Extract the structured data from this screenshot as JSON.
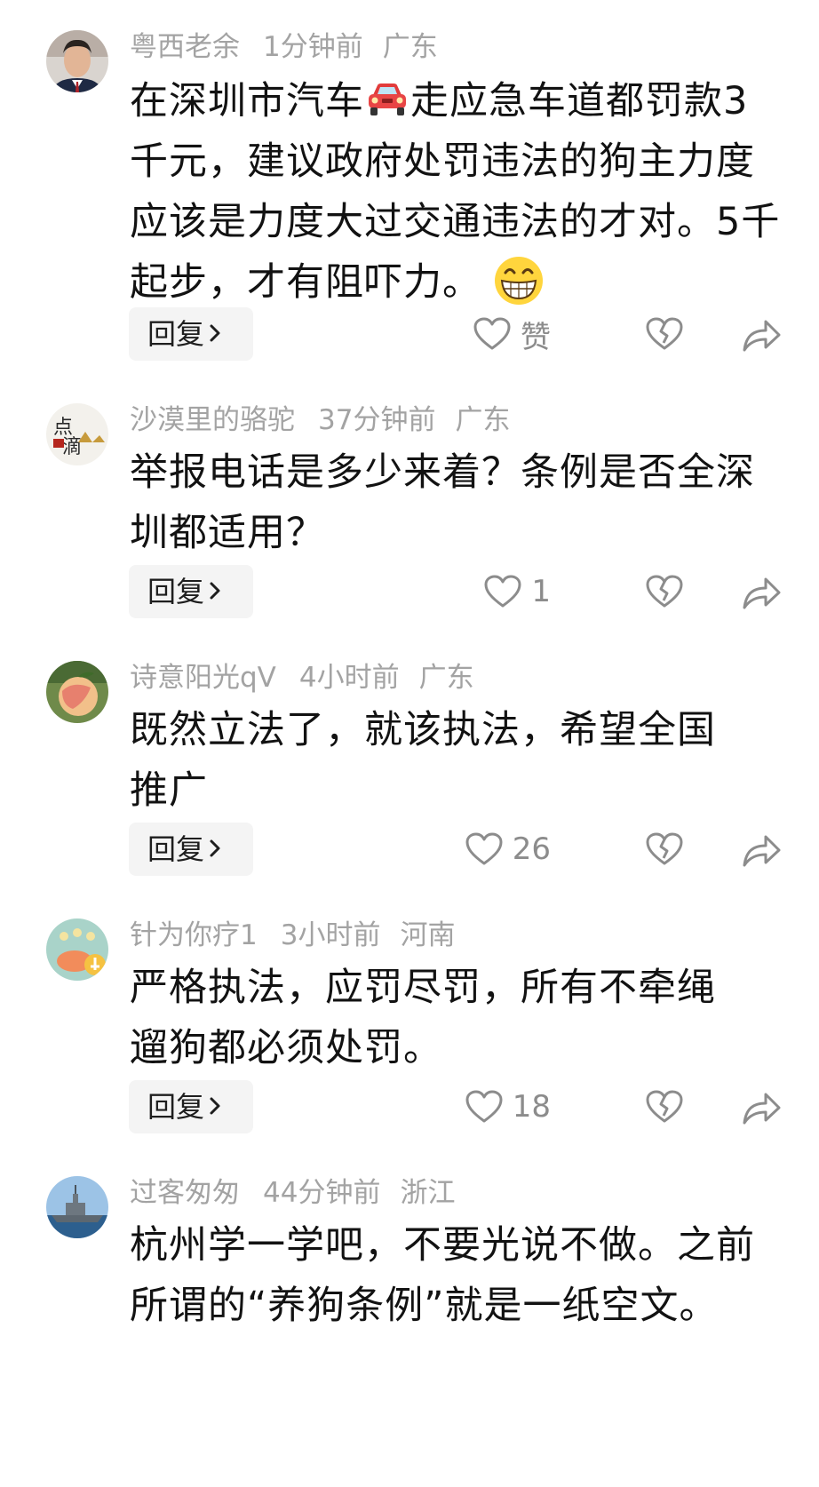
{
  "comments": [
    {
      "username": "粤西老余",
      "time": "1分钟前",
      "location": "广东",
      "text_before_emoji": "在深圳市汽车",
      "text_after_emoji": "走应急车道都罚款3千元，建议政府处罚违法的狗主力度应该是力度大过交通违法的才对。5千起步，才有阻吓力。",
      "reply_label": "回复",
      "like_label": "赞",
      "avatar": "man-portrait-avatar"
    },
    {
      "username": "沙漠里的骆驼",
      "time": "37分钟前",
      "location": "广东",
      "text": "举报电话是多少来着？条例是否全深圳都适用？",
      "reply_label": "回复",
      "like_count": "1",
      "avatar": "calligraphy-avatar"
    },
    {
      "username": "诗意阳光qV",
      "time": "4小时前",
      "location": "广东",
      "text": "既然立法了，就该执法，希望全国推广",
      "reply_label": "回复",
      "like_count": "26",
      "avatar": "peach-avatar"
    },
    {
      "username": "针为你疗1",
      "time": "3小时前",
      "location": "河南",
      "text": "严格执法，应罚尽罚，所有不牵绳遛狗都必须处罚。",
      "reply_label": "回复",
      "like_count": "18",
      "avatar": "cartoon-avatar"
    },
    {
      "username": "过客匆匆",
      "time": "44分钟前",
      "location": "浙江",
      "text": "杭州学一学吧，不要光说不做。之前所谓的“养狗条例”就是一纸空文。",
      "avatar": "warship-avatar"
    }
  ],
  "icons": {
    "car": "red-car-emoji",
    "grin": "grinning-face-emoji",
    "like": "heart-icon",
    "dislike": "broken-heart-icon",
    "share": "share-arrow-icon",
    "chevron": "chevron-right-icon"
  },
  "colors": {
    "meta": "#a3a3a3",
    "text": "#121212",
    "reply_bg": "#f4f4f4",
    "icon": "#8c8c8c"
  }
}
